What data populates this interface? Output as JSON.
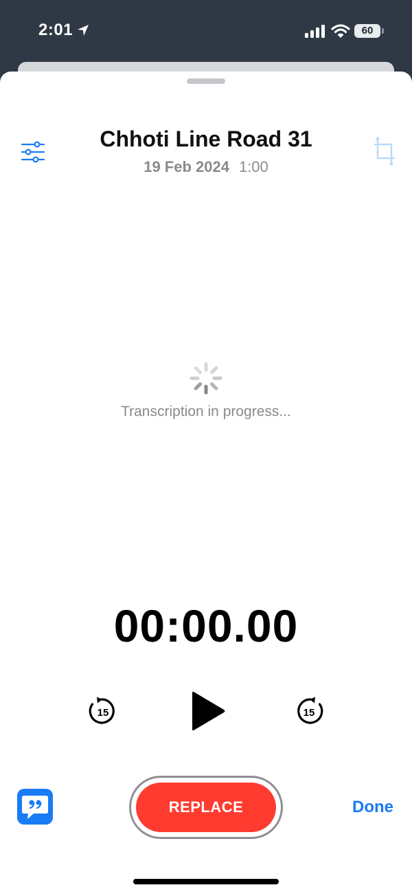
{
  "status_bar": {
    "time": "2:01",
    "battery": "60",
    "icons": [
      "location-arrow-icon",
      "cellular-signal-icon",
      "wifi-icon",
      "battery-icon"
    ]
  },
  "recording": {
    "title": "Chhoti Line Road 31",
    "date": "19 Feb 2024",
    "duration": "1:00"
  },
  "transcription": {
    "status_text": "Transcription in progress..."
  },
  "player": {
    "elapsed": "00:00.00",
    "skip_back_seconds": "15",
    "skip_forward_seconds": "15",
    "icons": [
      "skip-back-15-icon",
      "play-icon",
      "skip-forward-15-icon"
    ]
  },
  "toolbar": {
    "replace_label": "REPLACE",
    "done_label": "Done",
    "icons": [
      "sliders-icon",
      "crop-icon",
      "quote-bubble-icon"
    ]
  },
  "colors": {
    "accent": "#1a7cf5",
    "record_red": "#ff3b30",
    "secondary_text": "#8a8a8e",
    "status_bar_bg": "#2f3946"
  }
}
